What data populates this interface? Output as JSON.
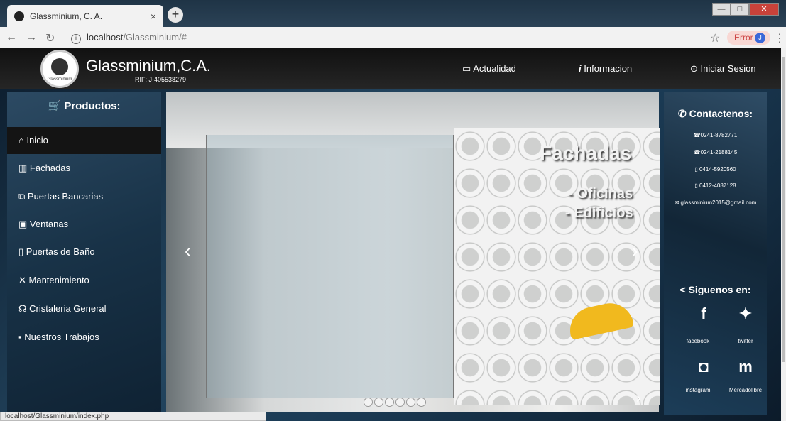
{
  "browser": {
    "tab_title": "Glassminium, C. A.",
    "tab_close": "×",
    "new_tab": "+",
    "url_host": "localhost",
    "url_path": "/Glassminium/#",
    "error_label": "Error",
    "avatar_letter": "J",
    "status_url": "localhost/Glassminium/index.php"
  },
  "header": {
    "logo_text": "Glassminium",
    "brand": "Glassminium,C.A.",
    "rif": "RIF: J-405538279",
    "nav": [
      {
        "icon": "calendar-icon",
        "label": "Actualidad"
      },
      {
        "icon": "info-icon",
        "label": "Informacion"
      },
      {
        "icon": "power-icon",
        "label": "Iniciar Sesion"
      }
    ]
  },
  "sidebar": {
    "title": "Productos:",
    "items": [
      {
        "icon": "home-icon",
        "label": "Inicio"
      },
      {
        "icon": "columns-icon",
        "label": "Fachadas"
      },
      {
        "icon": "doors-icon",
        "label": "Puertas Bancarias"
      },
      {
        "icon": "window-icon",
        "label": "Ventanas"
      },
      {
        "icon": "door-icon",
        "label": "Puertas de Baño"
      },
      {
        "icon": "tools-icon",
        "label": "Mantenimiento"
      },
      {
        "icon": "glass-icon",
        "label": "Cristaleria General"
      },
      {
        "icon": "briefcase-icon",
        "label": "Nuestros Trabajos"
      }
    ]
  },
  "carousel": {
    "title": "Fachadas",
    "lines": [
      "- Oficinas",
      "- Edificios"
    ],
    "prev": "‹",
    "next": "›",
    "slide_count": 6
  },
  "contact": {
    "title": "Contactenos:",
    "phones": [
      "0241-8782771",
      "0241-2188145",
      "0414-5920560",
      "0412-4087128"
    ],
    "email": "glassminium2015@gmail.com"
  },
  "social": {
    "title": "Siguenos en:",
    "items": [
      {
        "icon": "facebook-icon",
        "label": "facebook"
      },
      {
        "icon": "twitter-icon",
        "label": "twitter"
      },
      {
        "icon": "instagram-icon",
        "label": "instagram"
      },
      {
        "icon": "mercadolibre-icon",
        "label": "Mercadolibre"
      }
    ]
  },
  "colors": {
    "accent": "#f1b91e",
    "dark": "#141414",
    "header": "#1a1a1a"
  }
}
